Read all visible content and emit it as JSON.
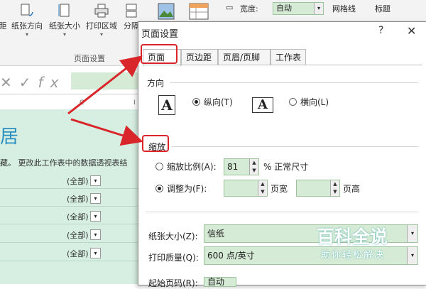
{
  "ribbon": {
    "buttons": [
      {
        "label": "距",
        "icon": "margins-icon"
      },
      {
        "label": "纸张方向",
        "icon": "orientation-icon"
      },
      {
        "label": "纸张大小",
        "icon": "paper-size-icon"
      },
      {
        "label": "打印区域",
        "icon": "printer-icon"
      },
      {
        "label": "分隔",
        "icon": "breaks-icon"
      }
    ],
    "group_label": "页面设置",
    "width_label": "宽度:",
    "width_value": "自动",
    "gridlines_label": "网格线",
    "headings_label": "标题"
  },
  "formula_bar": {
    "fx": "fx"
  },
  "sheet": {
    "col_c": "C",
    "col_i": "I",
    "title_fragment": "居",
    "description": "藏。 更改此工作表中的数据透视表结",
    "filters": [
      "(全部)",
      "(全部)",
      "(全部)",
      "(全部)",
      "(全部)"
    ]
  },
  "dialog": {
    "title": "页面设置",
    "help": "?",
    "close": "✕",
    "tabs": [
      "页面",
      "页边距",
      "页眉/页脚",
      "工作表"
    ],
    "orientation": {
      "section": "方向",
      "portrait": "纵向(T)",
      "landscape": "横向(L)",
      "icon_letter": "A"
    },
    "scaling": {
      "section": "缩放",
      "adjust_to_label": "缩放比例(A):",
      "adjust_to_value": "81",
      "adjust_to_suffix": "% 正常尺寸",
      "fit_to_label": "调整为(F):",
      "pages_wide": "页宽",
      "pages_tall": "页高"
    },
    "paper_size_label": "纸张大小(Z):",
    "paper_size_value": "信纸",
    "print_quality_label": "打印质量(Q):",
    "print_quality_value": "600 点/英寸",
    "first_page_label": "起始页码(R):",
    "first_page_value": "自动"
  },
  "watermark": {
    "main": "百科全说",
    "sub": "助你轻松解决"
  },
  "colors": {
    "highlight": "#d9262b",
    "field_bg": "#d6ebd5",
    "sheet_bg": "#d7efe3",
    "title_blue": "#2a8fbf"
  }
}
